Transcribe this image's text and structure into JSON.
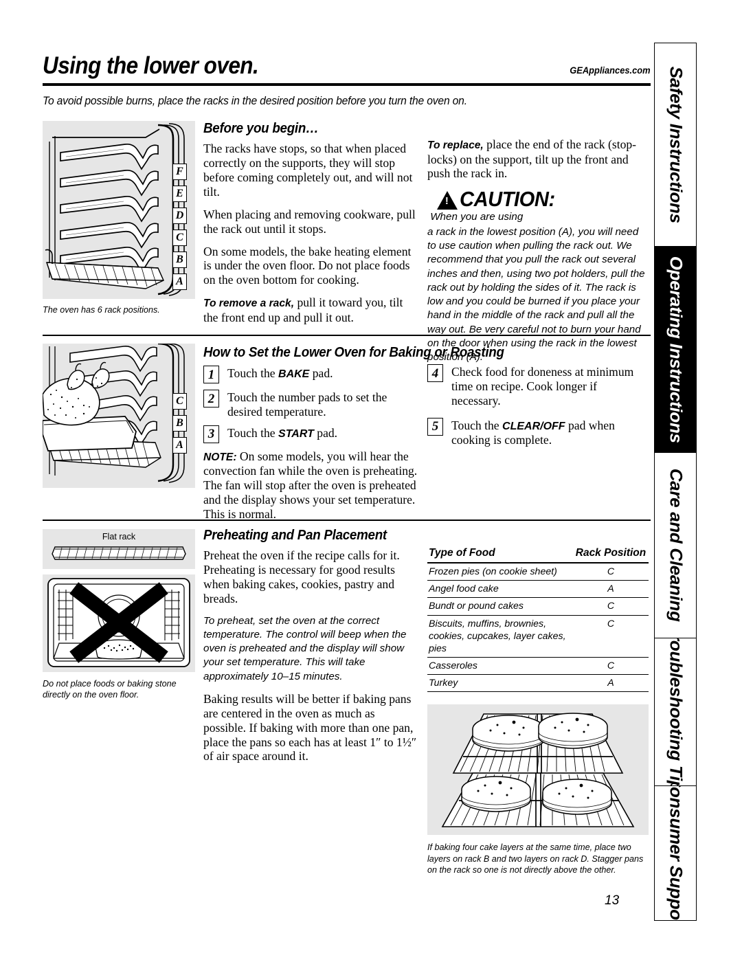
{
  "header": {
    "title": "Using the lower oven.",
    "website": "GEAppliances.com",
    "subhead": "To avoid possible burns, place the racks in the desired position before you turn the oven on."
  },
  "side_tabs": [
    {
      "label": "Safety Instructions",
      "active": false
    },
    {
      "label": "Operating Instructions",
      "active": true
    },
    {
      "label": "Care and Cleaning",
      "active": false
    },
    {
      "label": "Troubleshooting Tips",
      "active": false
    },
    {
      "label": "Consumer Support",
      "active": false
    }
  ],
  "section_before": {
    "heading": "Before you begin…",
    "paragraphs": [
      "The racks have stops, so that when placed correctly on the supports, they will stop before coming completely out, and will not tilt.",
      "When placing and removing cookware, pull the rack out until it stops.",
      "On some models, the bake heating element is under the oven floor. Do not place foods on the oven bottom for cooking."
    ],
    "remove_lead": "To remove a rack,",
    "remove_rest": " pull it toward you, tilt the front end up and pull it out.",
    "replace_lead": "To replace,",
    "replace_rest": " place the end of the rack (stop-locks) on the support, tilt up the front and push the rack in."
  },
  "caution": {
    "word": "CAUTION:",
    "icon": "warning-triangle",
    "text": " When you are using a rack in the lowest position (A), you will need to use caution when pulling the rack out. We recommend that you pull the rack out several inches and then, using two pot holders, pull the rack out by holding the sides of it. The rack is low and you could be burned if you place your hand in the middle of the rack and pull all the way out. Be very careful not to burn your hand on the door when using the rack in the lowest position (A)."
  },
  "oven_illustration": {
    "caption": "The oven has 6 rack positions.",
    "rack_labels": [
      "F",
      "E",
      "D",
      "C",
      "B",
      "A"
    ]
  },
  "turkey_illustration": {
    "rack_labels": [
      "C",
      "B",
      "A"
    ]
  },
  "flat_rack_illustration": {
    "label": "Flat rack",
    "caption": "Do not place foods or baking stone directly on the oven floor."
  },
  "section_baking": {
    "heading": "How to Set the Lower Oven for Baking or Roasting",
    "steps_left": [
      {
        "num": "1",
        "lead": "Touch the ",
        "bold": "BAKE",
        "rest": " pad."
      },
      {
        "num": "2",
        "lead": "Touch the number pads to set the desired temperature.",
        "bold": "",
        "rest": ""
      },
      {
        "num": "3",
        "lead": "Touch the ",
        "bold": "START",
        "rest": " pad."
      }
    ],
    "note_lead": "NOTE:",
    "note_rest": " On some models, you will hear the convection fan while the oven is preheating. The fan will stop after the oven is preheated and the display shows your set temperature. This is normal.",
    "steps_right": [
      {
        "num": "4",
        "lead": "Check food for doneness at minimum time on recipe. Cook longer if necessary.",
        "bold": "",
        "rest": ""
      },
      {
        "num": "5",
        "lead": "Touch the ",
        "bold": "CLEAR/OFF",
        "rest": " pad when cooking is complete."
      }
    ]
  },
  "section_preheating": {
    "heading": "Preheating and Pan Placement",
    "para1": "Preheat the oven if the recipe calls for it. Preheating is necessary for good results when baking cakes, cookies, pastry and breads.",
    "para_italic": "To preheat, set the oven at the correct temperature. The control will beep when the oven is preheated and the display will show your set temperature. This will take approximately 10–15 minutes.",
    "para2": "Baking results will be better if baking pans are centered in the oven as much as possible. If baking with more than one pan, place the pans so each has at least 1″ to 1½″ of air space around it."
  },
  "rack_table": {
    "columns": [
      "Type of Food",
      "Rack Position"
    ],
    "rows": [
      {
        "food": "Frozen pies (on cookie sheet)",
        "position": "C"
      },
      {
        "food": "Angel food cake",
        "position": "A"
      },
      {
        "food": "Bundt or pound cakes",
        "position": "C"
      },
      {
        "food": "Biscuits, muffins, brownies, cookies, cupcakes, layer cakes, pies",
        "position": "C"
      },
      {
        "food": "Casseroles",
        "position": "C"
      },
      {
        "food": "Turkey",
        "position": "A"
      }
    ]
  },
  "cake_illustration": {
    "caption": "If baking four cake layers at the same time, place two layers on rack B and two layers on rack D. Stagger pans on the rack so one is not directly above the other."
  },
  "page_number": "13"
}
